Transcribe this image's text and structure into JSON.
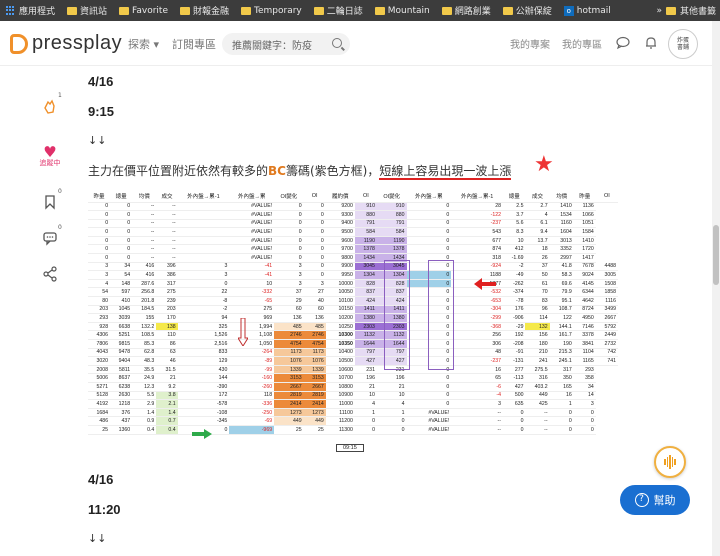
{
  "bookmarks": {
    "items": [
      {
        "label": "應用程式",
        "icon": "apps-grid-icon"
      },
      {
        "label": "資訊站",
        "icon": "folder-icon"
      },
      {
        "label": "Favorite",
        "icon": "folder-icon"
      },
      {
        "label": "財報金融",
        "icon": "folder-icon"
      },
      {
        "label": "Temporary",
        "icon": "folder-icon"
      },
      {
        "label": "二輪日誌",
        "icon": "folder-icon"
      },
      {
        "label": "Mountain",
        "icon": "folder-icon"
      },
      {
        "label": "網路創業",
        "icon": "folder-icon"
      },
      {
        "label": "公辦保綻",
        "icon": "folder-icon"
      },
      {
        "label": "hotmail",
        "icon": "outlook-icon"
      }
    ],
    "more": "»",
    "other": "其他書籤"
  },
  "header": {
    "logo_text": "pressplay",
    "nav": [
      "探索",
      "訂閱專區"
    ],
    "nav_dropdown": "▾",
    "search_placeholder": "推薦關鍵字：防疫",
    "right_links": [
      "我的專案",
      "我的專區"
    ],
    "avatar_text": "炸蛋\n書鋪"
  },
  "sidebar": {
    "like_count": "1",
    "follow_label": "追蹤中",
    "bookmark_count": "0",
    "comment_count": "0"
  },
  "post": {
    "heading1": "4/16",
    "time1": "9:15",
    "arrows1": "↓↓",
    "para_pre": "主力在價平位置附近依然有較多的",
    "para_bc": "BC",
    "para_mid": "籌碼(紫色方框)，",
    "para_ul": "短線上容易出現一波上漲",
    "heading2": "4/16",
    "time2": "11:20",
    "arrows2": "↓↓"
  },
  "sheet": {
    "headers": [
      "昨量",
      "總量",
      "均價",
      "成交",
      "外內盤→累-1",
      "外內盤→累",
      "OI變化",
      "OI",
      "履約價",
      "OI",
      "OI變化",
      "外內盤→累",
      "外內盤→累-1",
      "總量",
      "成交",
      "均價",
      "昨量",
      "OI"
    ],
    "rows": [
      [
        "0",
        "0",
        "--",
        "--",
        "",
        "#VALUE!",
        "0",
        "0",
        "9200",
        "910",
        "910",
        "0",
        "28",
        "2.5",
        "2.7",
        "1410",
        "1136"
      ],
      [
        "0",
        "0",
        "--",
        "--",
        "",
        "#VALUE!",
        "0",
        "0",
        "9300",
        "880",
        "880",
        "0",
        "-122",
        "3.7",
        "4",
        "1534",
        "1066"
      ],
      [
        "0",
        "0",
        "--",
        "--",
        "",
        "#VALUE!",
        "0",
        "0",
        "9400",
        "791",
        "791",
        "0",
        "-237",
        "5.6",
        "6.1",
        "1160",
        "1051"
      ],
      [
        "0",
        "0",
        "--",
        "--",
        "",
        "#VALUE!",
        "0",
        "0",
        "9500",
        "584",
        "584",
        "0",
        "543",
        "8.3",
        "9.4",
        "1604",
        "1584"
      ],
      [
        "0",
        "0",
        "--",
        "--",
        "",
        "#VALUE!",
        "0",
        "0",
        "9600",
        "1190",
        "1190",
        "0",
        "677",
        "10",
        "13.7",
        "3013",
        "1410"
      ],
      [
        "0",
        "0",
        "--",
        "--",
        "",
        "#VALUE!",
        "0",
        "0",
        "9700",
        "1378",
        "1378",
        "0",
        "874",
        "412",
        "18",
        "3352",
        "1720"
      ],
      [
        "0",
        "0",
        "--",
        "--",
        "",
        "#VALUE!",
        "0",
        "0",
        "9800",
        "1434",
        "1434",
        "0",
        "318",
        "-1.69",
        "26",
        "2997",
        "1417"
      ],
      [
        "3",
        "34",
        "416",
        "396",
        "3",
        "-41",
        "3",
        "0",
        "9900",
        "3045",
        "3045",
        "0",
        "-924",
        "-2",
        "37",
        "41.8",
        "7678",
        "4488"
      ],
      [
        "3",
        "54",
        "416",
        "386",
        "3",
        "-41",
        "3",
        "0",
        "9950",
        "1304",
        "1304",
        "0",
        "1188",
        "-49",
        "50",
        "58.3",
        "9024",
        "3005"
      ],
      [
        "4",
        "148",
        "287.6",
        "317",
        "0",
        "10",
        "3",
        "3",
        "10000",
        "828",
        "828",
        "0",
        "1377",
        "-262",
        "61",
        "69.6",
        "4145",
        "1508"
      ],
      [
        "54",
        "597",
        "256.8",
        "275",
        "22",
        "-332",
        "37",
        "27",
        "10050",
        "837",
        "837",
        "0",
        "-532",
        "-374",
        "70",
        "79.9",
        "6344",
        "1858"
      ],
      [
        "80",
        "410",
        "201.8",
        "239",
        "-8",
        "-65",
        "29",
        "40",
        "10100",
        "424",
        "424",
        "0",
        "-653",
        "-78",
        "83",
        "95.1",
        "4642",
        "1116"
      ],
      [
        "203",
        "1045",
        "184.5",
        "203",
        "-2",
        "275",
        "60",
        "60",
        "10150",
        "1411",
        "1411",
        "0",
        "-304",
        "176",
        "96",
        "108.7",
        "8724",
        "3499"
      ],
      [
        "293",
        "3039",
        "155",
        "170",
        "94",
        "969",
        "136",
        "136",
        "10200",
        "1380",
        "1380",
        "0",
        "-299",
        "-906",
        "114",
        "122",
        "4950",
        "2667"
      ],
      [
        "928",
        "6638",
        "132.2",
        "138",
        "325",
        "1,994",
        "485",
        "485",
        "10250",
        "2303",
        "2303",
        "0",
        "-368",
        "-29",
        "132",
        "144.1",
        "7146",
        "5792"
      ],
      [
        "4306",
        "5251",
        "108.5",
        "110",
        "1,526",
        "1,108",
        "2746",
        "2746",
        "10300",
        "1132",
        "1132",
        "0",
        "256",
        "192",
        "156",
        "161.7",
        "3378",
        "2449"
      ],
      [
        "7806",
        "9815",
        "85.3",
        "86",
        "2,516",
        "1,050",
        "4754",
        "4754",
        "10350",
        "1644",
        "1644",
        "0",
        "306",
        "-208",
        "180",
        "190",
        "3841",
        "2732"
      ],
      [
        "4043",
        "9478",
        "62.8",
        "63",
        "833",
        "-264",
        "1173",
        "1173",
        "10400",
        "797",
        "797",
        "0",
        "48",
        "-91",
        "210",
        "215.3",
        "1104",
        "742"
      ],
      [
        "3020",
        "9404",
        "48.3",
        "46",
        "129",
        "-89",
        "1076",
        "1076",
        "10500",
        "427",
        "427",
        "0",
        "-237",
        "-131",
        "241",
        "245.1",
        "1165",
        "741"
      ],
      [
        "2008",
        "5811",
        "35.5",
        "31.5",
        "430",
        "-99",
        "1339",
        "1339",
        "10600",
        "231",
        "231",
        "0",
        "16",
        "277",
        "275.5",
        "317",
        "293"
      ],
      [
        "5006",
        "8637",
        "24.9",
        "21",
        "144",
        "-160",
        "3153",
        "3153",
        "10700",
        "196",
        "196",
        "0",
        "65",
        "-113",
        "316",
        "350",
        "358"
      ],
      [
        "5271",
        "6238",
        "12.3",
        "9.2",
        "-390",
        "-260",
        "2667",
        "2667",
        "10800",
        "21",
        "21",
        "0",
        "-6",
        "427",
        "403.2",
        "165",
        "34"
      ],
      [
        "5128",
        "2630",
        "5.5",
        "3.8",
        "172",
        "118",
        "2819",
        "2819",
        "10900",
        "10",
        "10",
        "0",
        "-4",
        "500",
        "449",
        "16",
        "14"
      ],
      [
        "4192",
        "1218",
        "2.9",
        "2.1",
        "-578",
        "-336",
        "2414",
        "2414",
        "11000",
        "4",
        "4",
        "0",
        "3",
        "635",
        "425",
        "1",
        "3"
      ],
      [
        "1684",
        "376",
        "1.4",
        "1.4",
        "-108",
        "-250",
        "1273",
        "1273",
        "11100",
        "1",
        "1",
        "#VALUE!",
        "--",
        "0",
        "--",
        "0",
        "0"
      ],
      [
        "486",
        "437",
        "0.9",
        "0.7",
        "-345",
        "-69",
        "449",
        "449",
        "11200",
        "0",
        "0",
        "#VALUE!",
        "--",
        "0",
        "--",
        "0",
        "0"
      ],
      [
        "25",
        "1360",
        "0.4",
        "0.4",
        "0",
        "-969",
        "25",
        "25",
        "11300",
        "0",
        "0",
        "#VALUE!",
        "--",
        "0",
        "--",
        "0",
        "0"
      ]
    ],
    "footer": "09:15"
  },
  "help_label": "幫助",
  "colors": {
    "accent": "#f0902a",
    "help": "#1a6fd1",
    "purple": "#9b6fd4",
    "orange": "#ec8a3a",
    "blue": "#9fd0e8",
    "yellow": "#f5e94a",
    "green": "#2eaa4a",
    "red": "#e02020"
  }
}
